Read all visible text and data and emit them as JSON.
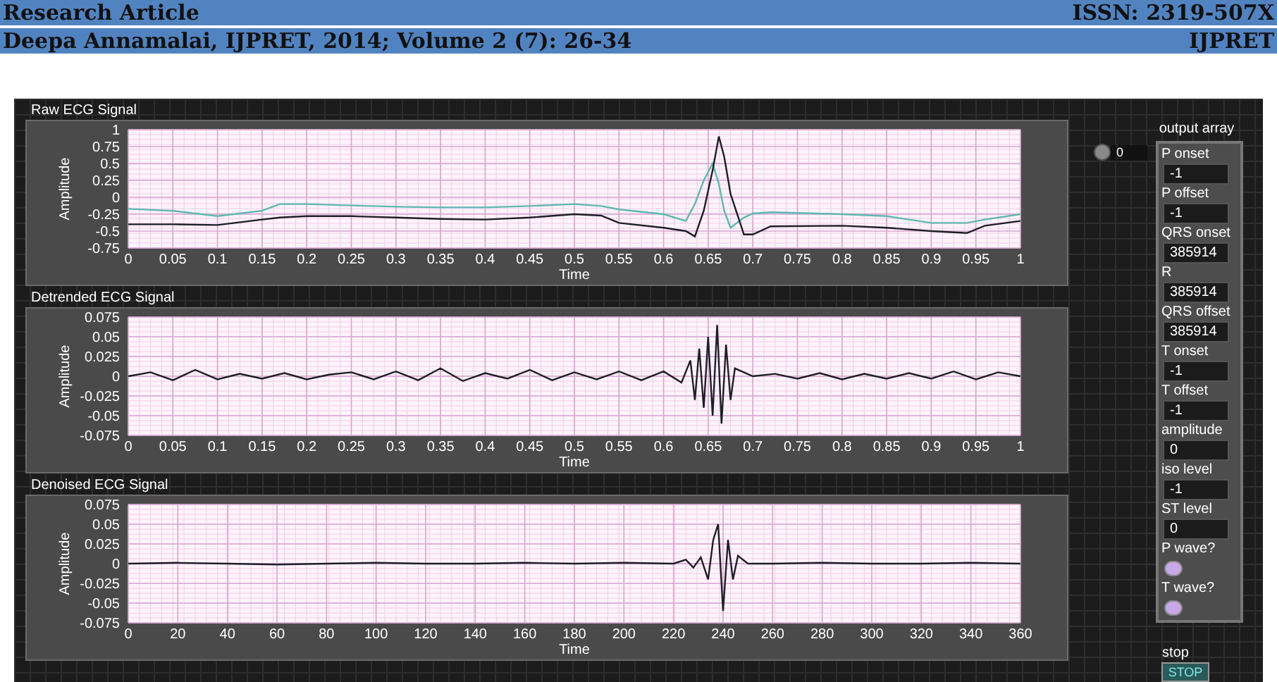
{
  "header": {
    "rows": [
      {
        "left": "Research Article",
        "right": "ISSN: 2319-507X"
      },
      {
        "left": "Deepa Annamalai, IJPRET, 2014; Volume 2 (7): 26-34",
        "right": "IJPRET"
      }
    ]
  },
  "charts": [
    {
      "chart_data": {
        "type": "line",
        "grid": true,
        "title": "Raw ECG Signal",
        "xlabel": "Time",
        "ylabel": "Amplitude",
        "xlim": [
          0,
          1
        ],
        "ylim": [
          -0.75,
          1
        ],
        "xticks": [
          {
            "value": 0,
            "label": "0"
          },
          {
            "value": 0.05,
            "label": "0.05"
          },
          {
            "value": 0.1,
            "label": "0.1"
          },
          {
            "value": 0.15,
            "label": "0.15"
          },
          {
            "value": 0.2,
            "label": "0.2"
          },
          {
            "value": 0.25,
            "label": "0.25"
          },
          {
            "value": 0.3,
            "label": "0.3"
          },
          {
            "value": 0.35,
            "label": "0.35"
          },
          {
            "value": 0.4,
            "label": "0.4"
          },
          {
            "value": 0.45,
            "label": "0.45"
          },
          {
            "value": 0.5,
            "label": "0.5"
          },
          {
            "value": 0.55,
            "label": "0.55"
          },
          {
            "value": 0.6,
            "label": "0.6"
          },
          {
            "value": 0.65,
            "label": "0.65"
          },
          {
            "value": 0.7,
            "label": "0.7"
          },
          {
            "value": 0.75,
            "label": "0.75"
          },
          {
            "value": 0.8,
            "label": "0.8"
          },
          {
            "value": 0.85,
            "label": "0.85"
          },
          {
            "value": 0.9,
            "label": "0.9"
          },
          {
            "value": 0.95,
            "label": "0.95"
          },
          {
            "value": 1,
            "label": "1"
          }
        ],
        "yticks": [
          {
            "value": 1,
            "label": "1"
          },
          {
            "value": 0.75,
            "label": "0.75"
          },
          {
            "value": 0.5,
            "label": "0.5"
          },
          {
            "value": 0.25,
            "label": "0.25"
          },
          {
            "value": 0,
            "label": "0"
          },
          {
            "value": -0.25,
            "label": "-0.25"
          },
          {
            "value": -0.5,
            "label": "-0.5"
          },
          {
            "value": -0.75,
            "label": "-0.75"
          }
        ],
        "x": [
          0,
          0.05,
          0.1,
          0.15,
          0.17,
          0.2,
          0.25,
          0.3,
          0.35,
          0.4,
          0.45,
          0.5,
          0.53,
          0.55,
          0.6,
          0.625,
          0.635,
          0.645,
          0.655,
          0.662,
          0.668,
          0.675,
          0.69,
          0.7,
          0.72,
          0.8,
          0.85,
          0.9,
          0.94,
          0.96,
          1
        ],
        "series": [
          {
            "color": "#5fb8b0",
            "values": [
              -0.17,
              -0.2,
              -0.28,
              -0.2,
              -0.1,
              -0.1,
              -0.12,
              -0.14,
              -0.15,
              -0.15,
              -0.13,
              -0.1,
              -0.13,
              -0.18,
              -0.25,
              -0.35,
              -0.1,
              0.25,
              0.5,
              0.2,
              -0.2,
              -0.45,
              -0.3,
              -0.24,
              -0.22,
              -0.25,
              -0.28,
              -0.38,
              -0.38,
              -0.33,
              -0.25
            ]
          },
          {
            "color": "#1e1e28",
            "values": [
              -0.4,
              -0.4,
              -0.41,
              -0.33,
              -0.3,
              -0.28,
              -0.28,
              -0.3,
              -0.32,
              -0.33,
              -0.3,
              -0.25,
              -0.27,
              -0.38,
              -0.45,
              -0.5,
              -0.58,
              -0.2,
              0.4,
              0.9,
              0.6,
              0.05,
              -0.55,
              -0.55,
              -0.43,
              -0.42,
              -0.45,
              -0.5,
              -0.53,
              -0.42,
              -0.35
            ]
          }
        ]
      }
    },
    {
      "chart_data": {
        "type": "line",
        "grid": true,
        "title": "Detrended ECG Signal",
        "xlabel": "Time",
        "ylabel": "Amplitude",
        "xlim": [
          0,
          1
        ],
        "ylim": [
          -0.075,
          0.075
        ],
        "xticks": [
          {
            "value": 0,
            "label": "0"
          },
          {
            "value": 0.05,
            "label": "0.05"
          },
          {
            "value": 0.1,
            "label": "0.1"
          },
          {
            "value": 0.15,
            "label": "0.15"
          },
          {
            "value": 0.2,
            "label": "0.2"
          },
          {
            "value": 0.25,
            "label": "0.25"
          },
          {
            "value": 0.3,
            "label": "0.3"
          },
          {
            "value": 0.35,
            "label": "0.35"
          },
          {
            "value": 0.4,
            "label": "0.4"
          },
          {
            "value": 0.45,
            "label": "0.45"
          },
          {
            "value": 0.5,
            "label": "0.5"
          },
          {
            "value": 0.55,
            "label": "0.55"
          },
          {
            "value": 0.6,
            "label": "0.6"
          },
          {
            "value": 0.65,
            "label": "0.65"
          },
          {
            "value": 0.7,
            "label": "0.7"
          },
          {
            "value": 0.75,
            "label": "0.75"
          },
          {
            "value": 0.8,
            "label": "0.8"
          },
          {
            "value": 0.85,
            "label": "0.85"
          },
          {
            "value": 0.9,
            "label": "0.9"
          },
          {
            "value": 0.95,
            "label": "0.95"
          },
          {
            "value": 1,
            "label": "1"
          }
        ],
        "yticks": [
          {
            "value": 0.075,
            "label": "0.075"
          },
          {
            "value": 0.05,
            "label": "0.05"
          },
          {
            "value": 0.025,
            "label": "0.025"
          },
          {
            "value": 0,
            "label": "0"
          },
          {
            "value": -0.025,
            "label": "-0.025"
          },
          {
            "value": -0.05,
            "label": "-0.05"
          },
          {
            "value": -0.075,
            "label": "-0.075"
          }
        ],
        "x": [
          0,
          0.025,
          0.05,
          0.075,
          0.1,
          0.125,
          0.15,
          0.175,
          0.2,
          0.225,
          0.25,
          0.275,
          0.3,
          0.325,
          0.35,
          0.375,
          0.4,
          0.425,
          0.45,
          0.475,
          0.5,
          0.525,
          0.55,
          0.575,
          0.6,
          0.62,
          0.63,
          0.635,
          0.64,
          0.645,
          0.65,
          0.655,
          0.66,
          0.665,
          0.67,
          0.675,
          0.68,
          0.7,
          0.725,
          0.75,
          0.775,
          0.8,
          0.825,
          0.85,
          0.875,
          0.9,
          0.925,
          0.95,
          0.975,
          1
        ],
        "series": [
          {
            "color": "#1e1e28",
            "values": [
              0,
              0.005,
              -0.005,
              0.008,
              -0.004,
              0.003,
              -0.003,
              0.004,
              -0.004,
              0.002,
              0.005,
              -0.004,
              0.006,
              -0.005,
              0.01,
              -0.006,
              0.004,
              -0.003,
              0.008,
              -0.005,
              0.005,
              -0.004,
              0.006,
              -0.005,
              0.006,
              -0.008,
              0.02,
              -0.03,
              0.035,
              -0.04,
              0.05,
              -0.05,
              0.065,
              -0.06,
              0.04,
              -0.03,
              0.01,
              0,
              0.003,
              -0.003,
              0.004,
              -0.004,
              0.003,
              -0.003,
              0.004,
              -0.003,
              0.006,
              -0.004,
              0.005,
              0
            ]
          }
        ]
      }
    },
    {
      "chart_data": {
        "type": "line",
        "grid": true,
        "title": "Denoised ECG Signal",
        "xlabel": "Time",
        "ylabel": "Amplitude",
        "xlim": [
          0,
          360
        ],
        "ylim": [
          -0.075,
          0.075
        ],
        "xticks": [
          0,
          20,
          40,
          60,
          80,
          100,
          120,
          140,
          160,
          180,
          200,
          220,
          240,
          260,
          280,
          300,
          320,
          340,
          360
        ],
        "yticks": [
          {
            "value": 0.075,
            "label": "0.075"
          },
          {
            "value": 0.05,
            "label": "0.05"
          },
          {
            "value": 0.025,
            "label": "0.025"
          },
          {
            "value": 0,
            "label": "0"
          },
          {
            "value": -0.025,
            "label": "-0.025"
          },
          {
            "value": -0.05,
            "label": "-0.05"
          },
          {
            "value": -0.075,
            "label": "-0.075"
          }
        ],
        "x": [
          0,
          20,
          40,
          60,
          80,
          100,
          120,
          140,
          160,
          180,
          200,
          220,
          225,
          228,
          231,
          234,
          236,
          238,
          240,
          242,
          244,
          246,
          250,
          260,
          280,
          300,
          320,
          340,
          360
        ],
        "series": [
          {
            "color": "#1e1e28",
            "values": [
              0,
              0.001,
              0,
              -0.001,
              0,
              0.001,
              0,
              0,
              0.001,
              0,
              0.001,
              0,
              0.005,
              -0.005,
              0.008,
              -0.02,
              0.03,
              0.05,
              -0.06,
              0.03,
              -0.02,
              0.01,
              0,
              0,
              0.001,
              0,
              0,
              0.001,
              0
            ]
          }
        ]
      }
    }
  ],
  "index_control": {
    "value": "0"
  },
  "output_array": {
    "label": "output array",
    "items": [
      {
        "kind": "field",
        "label": "P onset",
        "value": "-1"
      },
      {
        "kind": "field",
        "label": "P offset",
        "value": "-1"
      },
      {
        "kind": "field",
        "label": "QRS onset",
        "value": "385914"
      },
      {
        "kind": "field",
        "label": "R",
        "value": "385914"
      },
      {
        "kind": "field",
        "label": "QRS offset",
        "value": "385914"
      },
      {
        "kind": "field",
        "label": "T onset",
        "value": "-1"
      },
      {
        "kind": "field",
        "label": "T offset",
        "value": "-1"
      },
      {
        "kind": "field",
        "label": "amplitude",
        "value": "0"
      },
      {
        "kind": "field",
        "label": "iso level",
        "value": "-1"
      },
      {
        "kind": "field",
        "label": "ST level",
        "value": "0"
      },
      {
        "kind": "led",
        "label": "P wave?",
        "on": false
      },
      {
        "kind": "led",
        "label": "T wave?",
        "on": false
      }
    ]
  },
  "stop": {
    "label": "stop",
    "button": "STOP"
  }
}
